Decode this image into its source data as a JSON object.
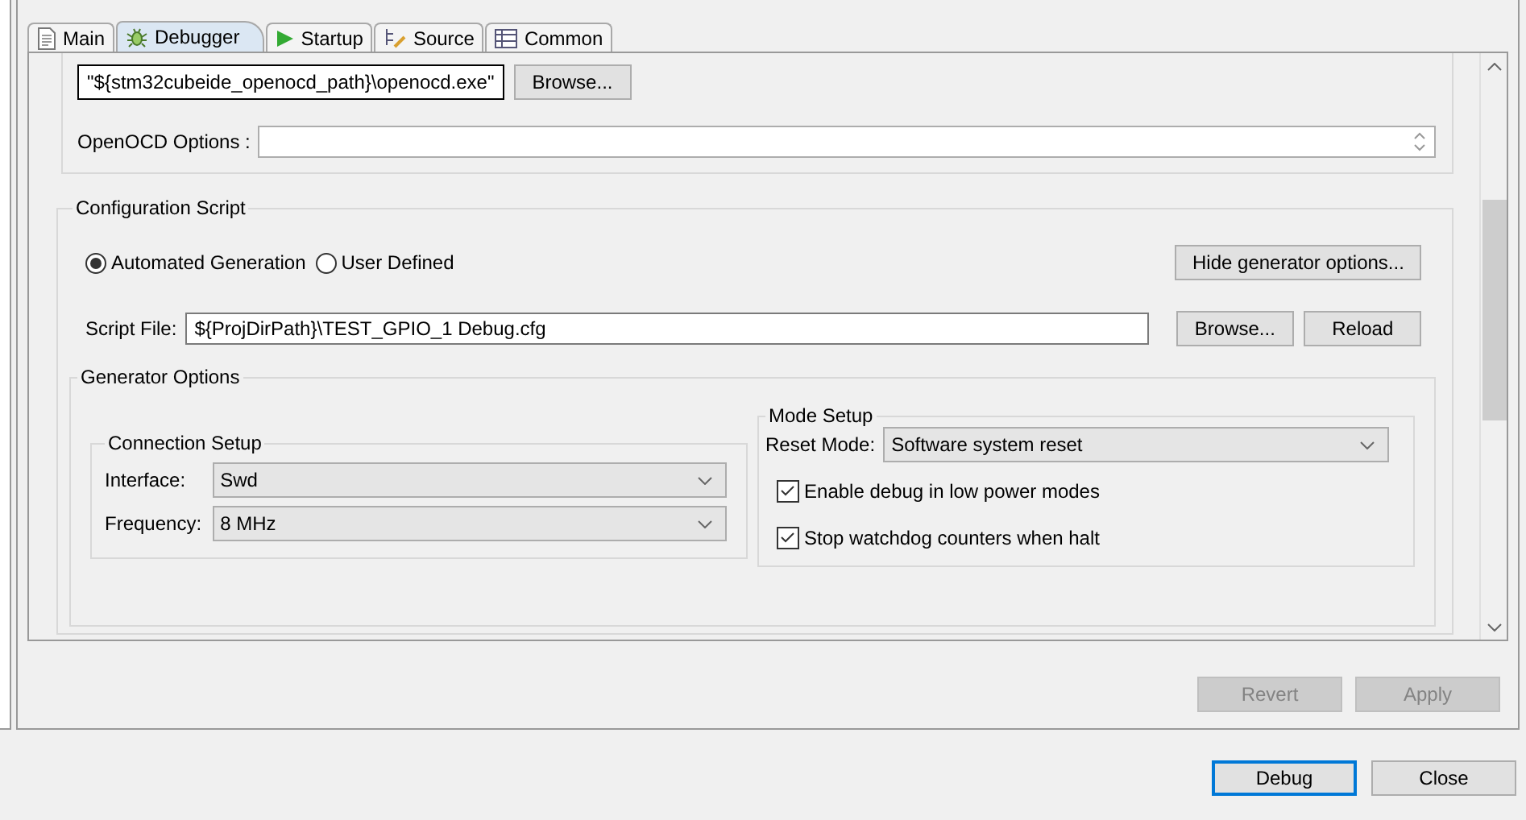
{
  "tabs": [
    {
      "label": "Main",
      "kind": "document",
      "selected": false
    },
    {
      "label": "Debugger",
      "kind": "bug",
      "selected": true
    },
    {
      "label": "Startup",
      "kind": "play",
      "selected": false
    },
    {
      "label": "Source",
      "kind": "source",
      "selected": false
    },
    {
      "label": "Common",
      "kind": "table",
      "selected": false
    }
  ],
  "gdb_server": {
    "path_value": "\"${stm32cubeide_openocd_path}\\openocd.exe\"",
    "browse_button": "Browse...",
    "options_label": "OpenOCD Options :"
  },
  "configuration_script": {
    "title": "Configuration Script",
    "radios": [
      {
        "label": "Automated Generation",
        "selected": true
      },
      {
        "label": "User Defined",
        "selected": false
      }
    ],
    "hide_button": "Hide generator options...",
    "script_file": {
      "label": "Script File:",
      "value": "${ProjDirPath}\\TEST_GPIO_1 Debug.cfg"
    },
    "browse_button": "Browse...",
    "reload_button": "Reload",
    "generator_options": {
      "title": "Generator Options",
      "connection_setup": {
        "title": "Connection Setup",
        "fields": [
          {
            "label": "Interface:",
            "value": "Swd"
          },
          {
            "label": "Frequency:",
            "value": "8 MHz"
          }
        ]
      },
      "mode_setup": {
        "title": "Mode Setup",
        "reset_mode": {
          "label": "Reset Mode:",
          "value": "Software system reset"
        },
        "checkboxes": [
          {
            "label": "Enable debug in low power modes",
            "checked": true
          },
          {
            "label": "Stop watchdog counters when halt",
            "checked": true
          }
        ]
      }
    }
  },
  "panel_buttons": [
    {
      "label": "Revert",
      "disabled": true
    },
    {
      "label": "Apply",
      "disabled": true
    }
  ],
  "dialog_buttons": [
    {
      "label": "Debug",
      "default": true
    },
    {
      "label": "Close",
      "default": false
    }
  ]
}
